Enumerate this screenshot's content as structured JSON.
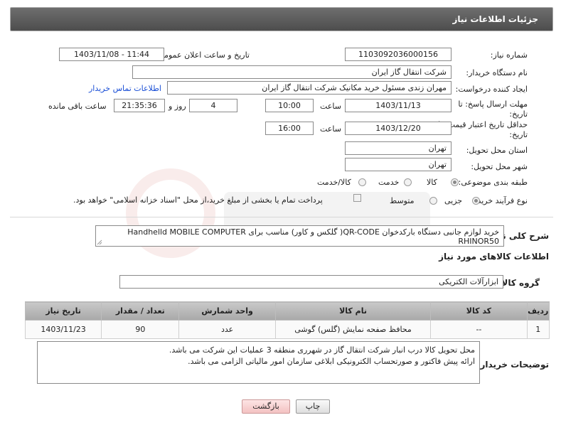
{
  "header": {
    "title": "جزئیات اطلاعات نیاز"
  },
  "fields": {
    "need_number_label": "شماره نیاز:",
    "need_number": "1103092036000156",
    "announce_label": "تاریخ و ساعت اعلان عمومی:",
    "announce_value": "1403/11/08 - 11:44",
    "buyer_org_label": "نام دستگاه خریدار:",
    "buyer_org": "شرکت انتقال گاز ایران",
    "requester_label": "ایجاد کننده درخواست:",
    "requester": "مهران زندی مسئول خرید مکانیک شرکت انتقال گاز ایران",
    "contact_link": "اطلاعات تماس خریدار",
    "deadline_label_1": "مهلت ارسال پاسخ: تا",
    "deadline_label_2": "تاریخ:",
    "deadline_date": "1403/11/13",
    "hour_label": "ساعت",
    "deadline_time": "10:00",
    "days_value": "4",
    "days_label": "روز و",
    "remaining_time": "21:35:36",
    "remaining_label": "ساعت باقی مانده",
    "validity_label_1": "حداقل تاریخ اعتبار قیمت: تا",
    "validity_label_2": "تاریخ:",
    "validity_date": "1403/12/20",
    "validity_time": "16:00",
    "province_label": "استان محل تحویل:",
    "province": "تهران",
    "city_label": "شهر محل تحویل:",
    "city": "تهران",
    "category_label": "طبقه بندی موضوعی:",
    "category_options": [
      "کالا",
      "خدمت",
      "کالا/خدمت"
    ],
    "process_label": "نوع فرآیند خرید :",
    "process_options": [
      "جزیی",
      "متوسط"
    ],
    "payment_text": "پرداخت تمام یا بخشی از مبلغ خرید،از محل \"اسناد خزانه اسلامی\" خواهد بود."
  },
  "summary": {
    "label": "شرح کلی نیاز:",
    "text": "خرید  لوازم جانبی دستگاه بارکدخوان QR-CODE( گلکس و کاور) مناسب برای Handhelld MOBILE COMPUTER RHINOR50"
  },
  "goods_info": {
    "title": "اطلاعات کالاهای مورد نیاز",
    "group_label": "گروه کالا:",
    "group_value": "ابزارآلات الکتریکی"
  },
  "table": {
    "headers": [
      "ردیف",
      "کد کالا",
      "نام کالا",
      "واحد شمارش",
      "تعداد / مقدار",
      "تاریخ نیاز"
    ],
    "rows": [
      [
        "1",
        "--",
        "محافظ صفحه نمایش (گلس) گوشی",
        "عدد",
        "90",
        "1403/11/23"
      ]
    ]
  },
  "buyer_notes": {
    "label": "توضیحات خریدار:",
    "line1": "محل تحویل کالا درب انبار شرکت انتقال گاز در شهرری منطقه 3 عملیات این شرکت می باشد.",
    "line2": "ارائه پیش فاکتور و صورتحساب الکترونیکی ابلاغی سازمان امور مالیاتی الزامی می باشد."
  },
  "buttons": {
    "print": "چاپ",
    "back": "بازگشت"
  },
  "colors": {
    "header_bg": "#5a5a5a",
    "link": "#1a4fd6",
    "back_button": "#f3c2c2"
  }
}
